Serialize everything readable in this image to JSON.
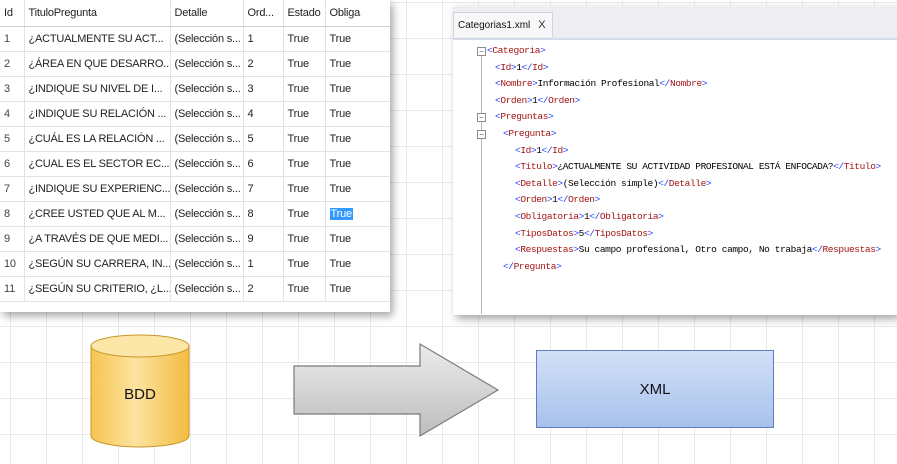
{
  "db_table": {
    "columns": [
      "Id",
      "TituloPregunta",
      "Detalle",
      "Ord...",
      "Estado",
      "Obliga"
    ],
    "rows": [
      [
        "1",
        "¿ACTUALMENTE SU ACT...",
        "(Selección s...",
        "1",
        "True",
        "True"
      ],
      [
        "2",
        "¿ÁREA EN QUE DESARRO...",
        "(Selección s...",
        "2",
        "True",
        "True"
      ],
      [
        "3",
        "¿INDIQUE SU NIVEL DE I...",
        "(Selección s...",
        "3",
        "True",
        "True"
      ],
      [
        "4",
        "¿INDIQUE SU RELACIÓN ...",
        "(Selección s...",
        "4",
        "True",
        "True"
      ],
      [
        "5",
        "¿CUÁL ES  LA RELACIÓN ...",
        "(Selección s...",
        "5",
        "True",
        "True"
      ],
      [
        "6",
        "¿CUAL ES EL SECTOR EC...",
        "(Selección s...",
        "6",
        "True",
        "True"
      ],
      [
        "7",
        "¿INDIQUE  SU EXPERIENC...",
        "(Selección s...",
        "7",
        "True",
        "True"
      ],
      [
        "8",
        "¿CREE  USTED QUE AL M...",
        "(Selección s...",
        "8",
        "True",
        "True"
      ],
      [
        "9",
        "¿A TRAVÉS DE QUE MEDI...",
        "(Selección s...",
        "9",
        "True",
        "True"
      ],
      [
        "10",
        "¿SEGÚN SU CARRERA, IN...",
        "(Selección s...",
        "1",
        "True",
        "True"
      ],
      [
        "11",
        "¿SEGÚN SU CRITERIO, ¿L...",
        "(Selección s...",
        "2",
        "True",
        "True"
      ]
    ],
    "selected_cell": {
      "row": 7,
      "col": 5
    },
    "selection_color": "#3399ff"
  },
  "xml_editor": {
    "tab_label": "Categorias1.xml",
    "tab_close": "X",
    "lines": [
      {
        "fold": "minus",
        "open": "Categoria",
        "text": "",
        "close": ""
      },
      {
        "fold": "",
        "open": "Id",
        "text": "1",
        "close": "Id"
      },
      {
        "fold": "",
        "open": "Nombre",
        "text": "Información Profesional",
        "close": "Nombre"
      },
      {
        "fold": "",
        "open": "Orden",
        "text": "1",
        "close": "Orden"
      },
      {
        "fold": "minus",
        "open": "Preguntas",
        "text": "",
        "close": ""
      },
      {
        "fold": "minus",
        "open": "Pregunta",
        "text": "",
        "close": ""
      },
      {
        "fold": "",
        "open": "Id",
        "text": "1",
        "close": "Id"
      },
      {
        "fold": "",
        "open": "Titulo",
        "text": "¿ACTUALMENTE SU ACTIVIDAD PROFESIONAL ESTÁ ENFOCADA?",
        "close": "Titulo"
      },
      {
        "fold": "",
        "open": "Detalle",
        "text": "(Selección simple)",
        "close": "Detalle"
      },
      {
        "fold": "",
        "open": "Orden",
        "text": "1",
        "close": "Orden"
      },
      {
        "fold": "",
        "open": "Obligatoria",
        "text": "1",
        "close": "Obligatoria"
      },
      {
        "fold": "",
        "open": "TiposDatos",
        "text": "5",
        "close": "TiposDatos"
      },
      {
        "fold": "",
        "open": "Respuestas",
        "text": "Su campo profesional, Otro campo, No trabaja",
        "close": "Respuestas"
      },
      {
        "fold": "",
        "open": "",
        "text": "",
        "close": "Pregunta"
      }
    ],
    "tag_color": "#a31515",
    "bracket_color": "#1a3cff"
  },
  "diagram": {
    "bdd_label": "BDD",
    "xml_label": "XML",
    "cylinder_color": "#fdd87a",
    "xml_box_color": "#b6cdf2",
    "arrow_color": "#c8c8c8"
  }
}
